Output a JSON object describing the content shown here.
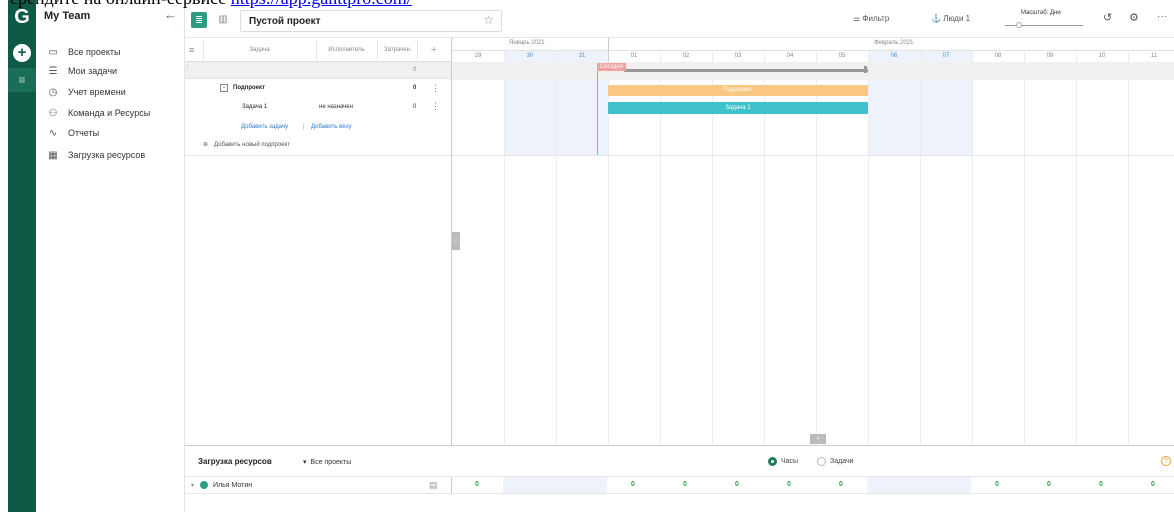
{
  "page_text": {
    "prefix": "ерендите на онлайн-сервисе ",
    "link": "https://app.ganttpro.com/"
  },
  "rail": {
    "logo": "G",
    "add": "+",
    "menu": "≡"
  },
  "sidebar": {
    "team": "My Team",
    "collapse": "←",
    "items": [
      {
        "icon": "folder-icon",
        "glyph": "▭",
        "label": "Все проекты"
      },
      {
        "icon": "tasks-icon",
        "glyph": "☰",
        "label": "Мои задачи"
      },
      {
        "icon": "clock-icon",
        "glyph": "◷",
        "label": "Учет времени"
      },
      {
        "icon": "team-icon",
        "glyph": "⚇",
        "label": "Команда и Ресурсы"
      },
      {
        "icon": "reports-icon",
        "glyph": "∿",
        "label": "Отчеты"
      },
      {
        "icon": "resource-load-icon",
        "glyph": "▦",
        "label": "Загрузка ресурсов"
      }
    ]
  },
  "toolbar": {
    "project_title": "Пустой проект",
    "filter": "Фильтр",
    "people": "Люди",
    "people_count": "1",
    "zoom_label": "Масштаб: Дни",
    "more": "···"
  },
  "grid": {
    "headers": {
      "task": "Задача",
      "assignee": "Исполнитель",
      "cost": "Затрачен"
    },
    "project_row_value": "0",
    "subproject": {
      "name": "Подпроект",
      "value": "0"
    },
    "task": {
      "name": "Задача 1",
      "assignee": "не назначен",
      "value": "0"
    },
    "add_task": "Добавить задачу",
    "separator": "|",
    "add_milestone": "Добавить веху",
    "add_subproject": "Добавить новый подпроект"
  },
  "timeline": {
    "months": [
      "Январь 2021",
      "Февраль 2021"
    ],
    "days": [
      "29",
      "30",
      "31",
      "01",
      "02",
      "03",
      "04",
      "05",
      "06",
      "07",
      "08",
      "09",
      "10",
      "11"
    ],
    "today": "Сегодня",
    "subproject_bar": "Подпроект",
    "task_bar": "Задача 1"
  },
  "resources": {
    "title": "Загрузка ресурсов",
    "filter": "Все проекты",
    "opt_hours": "Часы",
    "opt_tasks": "Задачи",
    "user": "Илья Мотин",
    "cells": [
      "0",
      "",
      "",
      "0",
      "0",
      "0",
      "0",
      "0",
      "",
      "",
      "0",
      "0",
      "0",
      "0"
    ]
  }
}
